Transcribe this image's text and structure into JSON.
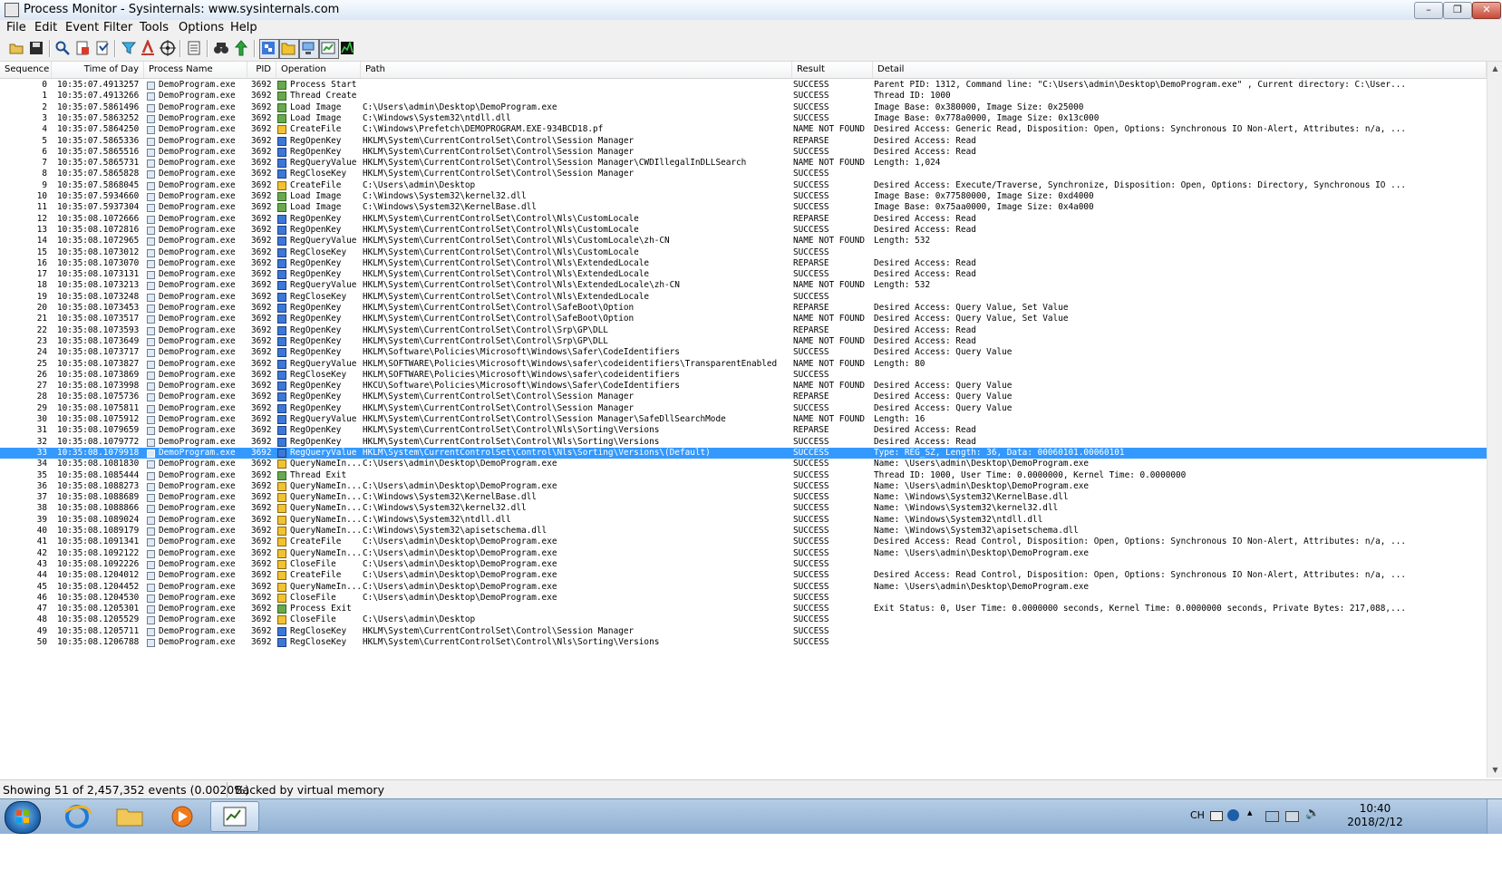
{
  "window": {
    "title": "Process Monitor - Sysinternals: www.sysinternals.com",
    "controls": {
      "minimize": "–",
      "maximize": "❐",
      "close": "✕"
    }
  },
  "menu": [
    "File",
    "Edit",
    "Event",
    "Filter",
    "Tools",
    "Options",
    "Help"
  ],
  "toolbar": {
    "icons": [
      "open-icon",
      "save-icon",
      "magnify-icon",
      "capture-icon",
      "autoscroll-icon",
      "clear-icon",
      "filter-icon",
      "highlight-icon",
      "target-icon",
      "jump-icon",
      "find-icon",
      "jump-to-icon",
      "registry-activity-icon",
      "file-activity-icon",
      "network-activity-icon",
      "process-activity-icon",
      "profiling-activity-icon"
    ]
  },
  "columns": [
    "Sequence",
    "Time of Day",
    "Process Name",
    "PID",
    "Operation",
    "Path",
    "Result",
    "Detail"
  ],
  "rows": [
    {
      "seq": "0",
      "time": "10:35:07.4913257",
      "pname": "DemoProgram.exe",
      "pid": "3692",
      "op": "Process Start",
      "icon": "proc",
      "path": "",
      "result": "SUCCESS",
      "detail": "Parent PID: 1312, Command line: \"C:\\Users\\admin\\Desktop\\DemoProgram.exe\" , Current directory: C:\\User..."
    },
    {
      "seq": "1",
      "time": "10:35:07.4913266",
      "pname": "DemoProgram.exe",
      "pid": "3692",
      "op": "Thread Create",
      "icon": "proc",
      "path": "",
      "result": "SUCCESS",
      "detail": "Thread ID: 1000"
    },
    {
      "seq": "2",
      "time": "10:35:07.5861496",
      "pname": "DemoProgram.exe",
      "pid": "3692",
      "op": "Load Image",
      "icon": "proc",
      "path": "C:\\Users\\admin\\Desktop\\DemoProgram.exe",
      "result": "SUCCESS",
      "detail": "Image Base: 0x380000, Image Size: 0x25000"
    },
    {
      "seq": "3",
      "time": "10:35:07.5863252",
      "pname": "DemoProgram.exe",
      "pid": "3692",
      "op": "Load Image",
      "icon": "proc",
      "path": "C:\\Windows\\System32\\ntdll.dll",
      "result": "SUCCESS",
      "detail": "Image Base: 0x778a0000, Image Size: 0x13c000"
    },
    {
      "seq": "4",
      "time": "10:35:07.5864250",
      "pname": "DemoProgram.exe",
      "pid": "3692",
      "op": "CreateFile",
      "icon": "file",
      "path": "C:\\Windows\\Prefetch\\DEMOPROGRAM.EXE-934BCD18.pf",
      "result": "NAME NOT FOUND",
      "detail": "Desired Access: Generic Read, Disposition: Open, Options: Synchronous IO Non-Alert, Attributes: n/a, ..."
    },
    {
      "seq": "5",
      "time": "10:35:07.5865336",
      "pname": "DemoProgram.exe",
      "pid": "3692",
      "op": "RegOpenKey",
      "icon": "reg",
      "path": "HKLM\\System\\CurrentControlSet\\Control\\Session Manager",
      "result": "REPARSE",
      "detail": "Desired Access: Read"
    },
    {
      "seq": "6",
      "time": "10:35:07.5865516",
      "pname": "DemoProgram.exe",
      "pid": "3692",
      "op": "RegOpenKey",
      "icon": "reg",
      "path": "HKLM\\System\\CurrentControlSet\\Control\\Session Manager",
      "result": "SUCCESS",
      "detail": "Desired Access: Read"
    },
    {
      "seq": "7",
      "time": "10:35:07.5865731",
      "pname": "DemoProgram.exe",
      "pid": "3692",
      "op": "RegQueryValue",
      "icon": "reg",
      "path": "HKLM\\System\\CurrentControlSet\\Control\\Session Manager\\CWDIllegalInDLLSearch",
      "result": "NAME NOT FOUND",
      "detail": "Length: 1,024"
    },
    {
      "seq": "8",
      "time": "10:35:07.5865828",
      "pname": "DemoProgram.exe",
      "pid": "3692",
      "op": "RegCloseKey",
      "icon": "reg",
      "path": "HKLM\\System\\CurrentControlSet\\Control\\Session Manager",
      "result": "SUCCESS",
      "detail": ""
    },
    {
      "seq": "9",
      "time": "10:35:07.5868045",
      "pname": "DemoProgram.exe",
      "pid": "3692",
      "op": "CreateFile",
      "icon": "file",
      "path": "C:\\Users\\admin\\Desktop",
      "result": "SUCCESS",
      "detail": "Desired Access: Execute/Traverse, Synchronize, Disposition: Open, Options: Directory, Synchronous IO ..."
    },
    {
      "seq": "10",
      "time": "10:35:07.5934660",
      "pname": "DemoProgram.exe",
      "pid": "3692",
      "op": "Load Image",
      "icon": "proc",
      "path": "C:\\Windows\\System32\\kernel32.dll",
      "result": "SUCCESS",
      "detail": "Image Base: 0x77580000, Image Size: 0xd4000"
    },
    {
      "seq": "11",
      "time": "10:35:07.5937304",
      "pname": "DemoProgram.exe",
      "pid": "3692",
      "op": "Load Image",
      "icon": "proc",
      "path": "C:\\Windows\\System32\\KernelBase.dll",
      "result": "SUCCESS",
      "detail": "Image Base: 0x75aa0000, Image Size: 0x4a000"
    },
    {
      "seq": "12",
      "time": "10:35:08.1072666",
      "pname": "DemoProgram.exe",
      "pid": "3692",
      "op": "RegOpenKey",
      "icon": "reg",
      "path": "HKLM\\System\\CurrentControlSet\\Control\\Nls\\CustomLocale",
      "result": "REPARSE",
      "detail": "Desired Access: Read"
    },
    {
      "seq": "13",
      "time": "10:35:08.1072816",
      "pname": "DemoProgram.exe",
      "pid": "3692",
      "op": "RegOpenKey",
      "icon": "reg",
      "path": "HKLM\\System\\CurrentControlSet\\Control\\Nls\\CustomLocale",
      "result": "SUCCESS",
      "detail": "Desired Access: Read"
    },
    {
      "seq": "14",
      "time": "10:35:08.1072965",
      "pname": "DemoProgram.exe",
      "pid": "3692",
      "op": "RegQueryValue",
      "icon": "reg",
      "path": "HKLM\\System\\CurrentControlSet\\Control\\Nls\\CustomLocale\\zh-CN",
      "result": "NAME NOT FOUND",
      "detail": "Length: 532"
    },
    {
      "seq": "15",
      "time": "10:35:08.1073012",
      "pname": "DemoProgram.exe",
      "pid": "3692",
      "op": "RegCloseKey",
      "icon": "reg",
      "path": "HKLM\\System\\CurrentControlSet\\Control\\Nls\\CustomLocale",
      "result": "SUCCESS",
      "detail": ""
    },
    {
      "seq": "16",
      "time": "10:35:08.1073070",
      "pname": "DemoProgram.exe",
      "pid": "3692",
      "op": "RegOpenKey",
      "icon": "reg",
      "path": "HKLM\\System\\CurrentControlSet\\Control\\Nls\\ExtendedLocale",
      "result": "REPARSE",
      "detail": "Desired Access: Read"
    },
    {
      "seq": "17",
      "time": "10:35:08.1073131",
      "pname": "DemoProgram.exe",
      "pid": "3692",
      "op": "RegOpenKey",
      "icon": "reg",
      "path": "HKLM\\System\\CurrentControlSet\\Control\\Nls\\ExtendedLocale",
      "result": "SUCCESS",
      "detail": "Desired Access: Read"
    },
    {
      "seq": "18",
      "time": "10:35:08.1073213",
      "pname": "DemoProgram.exe",
      "pid": "3692",
      "op": "RegQueryValue",
      "icon": "reg",
      "path": "HKLM\\System\\CurrentControlSet\\Control\\Nls\\ExtendedLocale\\zh-CN",
      "result": "NAME NOT FOUND",
      "detail": "Length: 532"
    },
    {
      "seq": "19",
      "time": "10:35:08.1073248",
      "pname": "DemoProgram.exe",
      "pid": "3692",
      "op": "RegCloseKey",
      "icon": "reg",
      "path": "HKLM\\System\\CurrentControlSet\\Control\\Nls\\ExtendedLocale",
      "result": "SUCCESS",
      "detail": ""
    },
    {
      "seq": "20",
      "time": "10:35:08.1073453",
      "pname": "DemoProgram.exe",
      "pid": "3692",
      "op": "RegOpenKey",
      "icon": "reg",
      "path": "HKLM\\System\\CurrentControlSet\\Control\\SafeBoot\\Option",
      "result": "REPARSE",
      "detail": "Desired Access: Query Value, Set Value"
    },
    {
      "seq": "21",
      "time": "10:35:08.1073517",
      "pname": "DemoProgram.exe",
      "pid": "3692",
      "op": "RegOpenKey",
      "icon": "reg",
      "path": "HKLM\\System\\CurrentControlSet\\Control\\SafeBoot\\Option",
      "result": "NAME NOT FOUND",
      "detail": "Desired Access: Query Value, Set Value"
    },
    {
      "seq": "22",
      "time": "10:35:08.1073593",
      "pname": "DemoProgram.exe",
      "pid": "3692",
      "op": "RegOpenKey",
      "icon": "reg",
      "path": "HKLM\\System\\CurrentControlSet\\Control\\Srp\\GP\\DLL",
      "result": "REPARSE",
      "detail": "Desired Access: Read"
    },
    {
      "seq": "23",
      "time": "10:35:08.1073649",
      "pname": "DemoProgram.exe",
      "pid": "3692",
      "op": "RegOpenKey",
      "icon": "reg",
      "path": "HKLM\\System\\CurrentControlSet\\Control\\Srp\\GP\\DLL",
      "result": "NAME NOT FOUND",
      "detail": "Desired Access: Read"
    },
    {
      "seq": "24",
      "time": "10:35:08.1073717",
      "pname": "DemoProgram.exe",
      "pid": "3692",
      "op": "RegOpenKey",
      "icon": "reg",
      "path": "HKLM\\Software\\Policies\\Microsoft\\Windows\\Safer\\CodeIdentifiers",
      "result": "SUCCESS",
      "detail": "Desired Access: Query Value"
    },
    {
      "seq": "25",
      "time": "10:35:08.1073827",
      "pname": "DemoProgram.exe",
      "pid": "3692",
      "op": "RegQueryValue",
      "icon": "reg",
      "path": "HKLM\\SOFTWARE\\Policies\\Microsoft\\Windows\\safer\\codeidentifiers\\TransparentEnabled",
      "result": "NAME NOT FOUND",
      "detail": "Length: 80"
    },
    {
      "seq": "26",
      "time": "10:35:08.1073869",
      "pname": "DemoProgram.exe",
      "pid": "3692",
      "op": "RegCloseKey",
      "icon": "reg",
      "path": "HKLM\\SOFTWARE\\Policies\\Microsoft\\Windows\\safer\\codeidentifiers",
      "result": "SUCCESS",
      "detail": ""
    },
    {
      "seq": "27",
      "time": "10:35:08.1073998",
      "pname": "DemoProgram.exe",
      "pid": "3692",
      "op": "RegOpenKey",
      "icon": "reg",
      "path": "HKCU\\Software\\Policies\\Microsoft\\Windows\\Safer\\CodeIdentifiers",
      "result": "NAME NOT FOUND",
      "detail": "Desired Access: Query Value"
    },
    {
      "seq": "28",
      "time": "10:35:08.1075736",
      "pname": "DemoProgram.exe",
      "pid": "3692",
      "op": "RegOpenKey",
      "icon": "reg",
      "path": "HKLM\\System\\CurrentControlSet\\Control\\Session Manager",
      "result": "REPARSE",
      "detail": "Desired Access: Query Value"
    },
    {
      "seq": "29",
      "time": "10:35:08.1075811",
      "pname": "DemoProgram.exe",
      "pid": "3692",
      "op": "RegOpenKey",
      "icon": "reg",
      "path": "HKLM\\System\\CurrentControlSet\\Control\\Session Manager",
      "result": "SUCCESS",
      "detail": "Desired Access: Query Value"
    },
    {
      "seq": "30",
      "time": "10:35:08.1075912",
      "pname": "DemoProgram.exe",
      "pid": "3692",
      "op": "RegQueryValue",
      "icon": "reg",
      "path": "HKLM\\System\\CurrentControlSet\\Control\\Session Manager\\SafeDllSearchMode",
      "result": "NAME NOT FOUND",
      "detail": "Length: 16"
    },
    {
      "seq": "31",
      "time": "10:35:08.1079659",
      "pname": "DemoProgram.exe",
      "pid": "3692",
      "op": "RegOpenKey",
      "icon": "reg",
      "path": "HKLM\\System\\CurrentControlSet\\Control\\Nls\\Sorting\\Versions",
      "result": "REPARSE",
      "detail": "Desired Access: Read"
    },
    {
      "seq": "32",
      "time": "10:35:08.1079772",
      "pname": "DemoProgram.exe",
      "pid": "3692",
      "op": "RegOpenKey",
      "icon": "reg",
      "path": "HKLM\\System\\CurrentControlSet\\Control\\Nls\\Sorting\\Versions",
      "result": "SUCCESS",
      "detail": "Desired Access: Read"
    },
    {
      "seq": "33",
      "time": "10:35:08.1079918",
      "pname": "DemoProgram.exe",
      "pid": "3692",
      "op": "RegQueryValue",
      "icon": "reg",
      "path": "HKLM\\System\\CurrentControlSet\\Control\\Nls\\Sorting\\Versions\\(Default)",
      "result": "SUCCESS",
      "detail": "Type: REG_SZ, Length: 36, Data: 00060101.00060101",
      "selected": true
    },
    {
      "seq": "34",
      "time": "10:35:08.1081830",
      "pname": "DemoProgram.exe",
      "pid": "3692",
      "op": "QueryNameIn...",
      "icon": "file",
      "path": "C:\\Users\\admin\\Desktop\\DemoProgram.exe",
      "result": "SUCCESS",
      "detail": "Name: \\Users\\admin\\Desktop\\DemoProgram.exe"
    },
    {
      "seq": "35",
      "time": "10:35:08.1085444",
      "pname": "DemoProgram.exe",
      "pid": "3692",
      "op": "Thread Exit",
      "icon": "proc",
      "path": "",
      "result": "SUCCESS",
      "detail": "Thread ID: 1000, User Time: 0.0000000, Kernel Time: 0.0000000"
    },
    {
      "seq": "36",
      "time": "10:35:08.1088273",
      "pname": "DemoProgram.exe",
      "pid": "3692",
      "op": "QueryNameIn...",
      "icon": "file",
      "path": "C:\\Users\\admin\\Desktop\\DemoProgram.exe",
      "result": "SUCCESS",
      "detail": "Name: \\Users\\admin\\Desktop\\DemoProgram.exe"
    },
    {
      "seq": "37",
      "time": "10:35:08.1088689",
      "pname": "DemoProgram.exe",
      "pid": "3692",
      "op": "QueryNameIn...",
      "icon": "file",
      "path": "C:\\Windows\\System32\\KernelBase.dll",
      "result": "SUCCESS",
      "detail": "Name: \\Windows\\System32\\KernelBase.dll"
    },
    {
      "seq": "38",
      "time": "10:35:08.1088866",
      "pname": "DemoProgram.exe",
      "pid": "3692",
      "op": "QueryNameIn...",
      "icon": "file",
      "path": "C:\\Windows\\System32\\kernel32.dll",
      "result": "SUCCESS",
      "detail": "Name: \\Windows\\System32\\kernel32.dll"
    },
    {
      "seq": "39",
      "time": "10:35:08.1089024",
      "pname": "DemoProgram.exe",
      "pid": "3692",
      "op": "QueryNameIn...",
      "icon": "file",
      "path": "C:\\Windows\\System32\\ntdll.dll",
      "result": "SUCCESS",
      "detail": "Name: \\Windows\\System32\\ntdll.dll"
    },
    {
      "seq": "40",
      "time": "10:35:08.1089179",
      "pname": "DemoProgram.exe",
      "pid": "3692",
      "op": "QueryNameIn...",
      "icon": "file",
      "path": "C:\\Windows\\System32\\apisetschema.dll",
      "result": "SUCCESS",
      "detail": "Name: \\Windows\\System32\\apisetschema.dll"
    },
    {
      "seq": "41",
      "time": "10:35:08.1091341",
      "pname": "DemoProgram.exe",
      "pid": "3692",
      "op": "CreateFile",
      "icon": "file",
      "path": "C:\\Users\\admin\\Desktop\\DemoProgram.exe",
      "result": "SUCCESS",
      "detail": "Desired Access: Read Control, Disposition: Open, Options: Synchronous IO Non-Alert, Attributes: n/a, ..."
    },
    {
      "seq": "42",
      "time": "10:35:08.1092122",
      "pname": "DemoProgram.exe",
      "pid": "3692",
      "op": "QueryNameIn...",
      "icon": "file",
      "path": "C:\\Users\\admin\\Desktop\\DemoProgram.exe",
      "result": "SUCCESS",
      "detail": "Name: \\Users\\admin\\Desktop\\DemoProgram.exe"
    },
    {
      "seq": "43",
      "time": "10:35:08.1092226",
      "pname": "DemoProgram.exe",
      "pid": "3692",
      "op": "CloseFile",
      "icon": "file",
      "path": "C:\\Users\\admin\\Desktop\\DemoProgram.exe",
      "result": "SUCCESS",
      "detail": ""
    },
    {
      "seq": "44",
      "time": "10:35:08.1204012",
      "pname": "DemoProgram.exe",
      "pid": "3692",
      "op": "CreateFile",
      "icon": "file",
      "path": "C:\\Users\\admin\\Desktop\\DemoProgram.exe",
      "result": "SUCCESS",
      "detail": "Desired Access: Read Control, Disposition: Open, Options: Synchronous IO Non-Alert, Attributes: n/a, ..."
    },
    {
      "seq": "45",
      "time": "10:35:08.1204452",
      "pname": "DemoProgram.exe",
      "pid": "3692",
      "op": "QueryNameIn...",
      "icon": "file",
      "path": "C:\\Users\\admin\\Desktop\\DemoProgram.exe",
      "result": "SUCCESS",
      "detail": "Name: \\Users\\admin\\Desktop\\DemoProgram.exe"
    },
    {
      "seq": "46",
      "time": "10:35:08.1204530",
      "pname": "DemoProgram.exe",
      "pid": "3692",
      "op": "CloseFile",
      "icon": "file",
      "path": "C:\\Users\\admin\\Desktop\\DemoProgram.exe",
      "result": "SUCCESS",
      "detail": ""
    },
    {
      "seq": "47",
      "time": "10:35:08.1205301",
      "pname": "DemoProgram.exe",
      "pid": "3692",
      "op": "Process Exit",
      "icon": "proc",
      "path": "",
      "result": "SUCCESS",
      "detail": "Exit Status: 0, User Time: 0.0000000 seconds, Kernel Time: 0.0000000 seconds, Private Bytes: 217,088,..."
    },
    {
      "seq": "48",
      "time": "10:35:08.1205529",
      "pname": "DemoProgram.exe",
      "pid": "3692",
      "op": "CloseFile",
      "icon": "file",
      "path": "C:\\Users\\admin\\Desktop",
      "result": "SUCCESS",
      "detail": ""
    },
    {
      "seq": "49",
      "time": "10:35:08.1205711",
      "pname": "DemoProgram.exe",
      "pid": "3692",
      "op": "RegCloseKey",
      "icon": "reg",
      "path": "HKLM\\System\\CurrentControlSet\\Control\\Session Manager",
      "result": "SUCCESS",
      "detail": ""
    },
    {
      "seq": "50",
      "time": "10:35:08.1206788",
      "pname": "DemoProgram.exe",
      "pid": "3692",
      "op": "RegCloseKey",
      "icon": "reg",
      "path": "HKLM\\System\\CurrentControlSet\\Control\\Nls\\Sorting\\Versions",
      "result": "SUCCESS",
      "detail": ""
    }
  ],
  "status": {
    "events": "Showing 51 of 2,457,352 events (0.0020%)",
    "memory": "Backed by virtual memory"
  },
  "taskbar": {
    "apps": [
      "internet-explorer-icon",
      "folder-icon",
      "media-player-icon",
      "process-monitor-icon"
    ],
    "tray": {
      "lang": "CH"
    },
    "clock": {
      "time": "10:40",
      "date": "2018/2/12"
    }
  },
  "colors": {
    "selection": "#3399ff",
    "titlebar": "#dbe7f5",
    "taskbar": "#8fb0d3"
  }
}
